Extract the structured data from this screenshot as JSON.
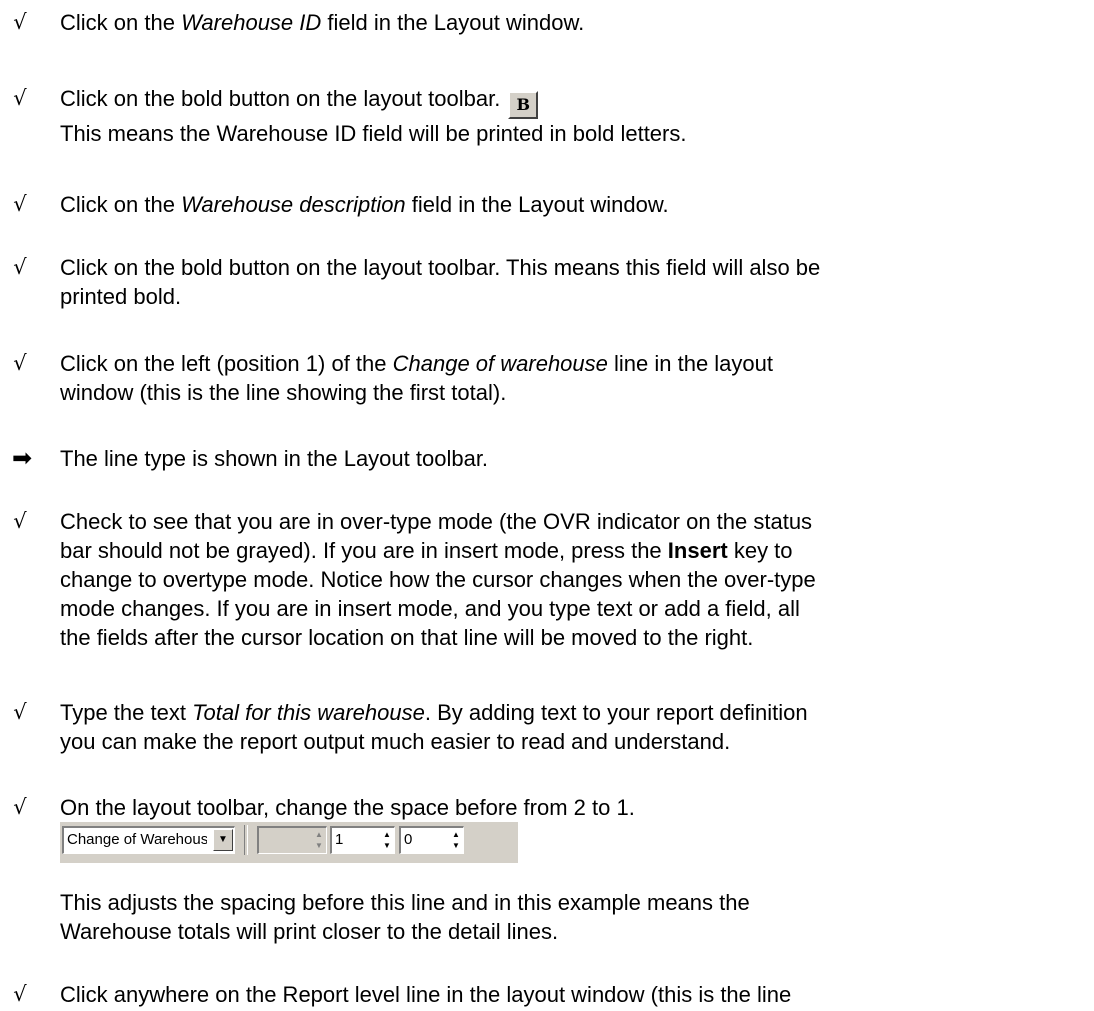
{
  "steps": [
    {
      "mark": "√",
      "pre": "Click on the ",
      "em": "Warehouse ID",
      "post": " field in the Layout window."
    },
    {
      "mark": "√",
      "line1": "Click on the bold button on the layout toolbar.",
      "button_label": "B",
      "line2": "This means the Warehouse ID field will be printed in bold letters."
    },
    {
      "mark": "√",
      "pre": "Click on the ",
      "em": "Warehouse description",
      "post": " field in the Layout window."
    },
    {
      "mark": "√",
      "line1": "Click on the bold button on the layout toolbar. This means this field will also be",
      "line2": "printed bold."
    },
    {
      "mark": "√",
      "pre": "Click on the left (position 1) of the ",
      "em": "Change of warehouse",
      "post": " line in the layout",
      "line2": "window (this is the line showing the first total)."
    },
    {
      "mark": "➡",
      "text": "The line type is shown in the Layout toolbar."
    },
    {
      "mark": "√",
      "line1": "Check to see that you are in over-type mode (the OVR indicator on the status",
      "line2_pre": "bar should not be grayed). If you are in insert mode, press the ",
      "line2_bold": "Insert",
      "line2_post": " key to",
      "line3": "change to overtype mode. Notice how the cursor changes when the over-type",
      "line4": "mode changes. If you are in insert mode, and you type text or add a field, all",
      "line5": "the fields after the cursor location on that line will be moved to the right."
    },
    {
      "mark": "√",
      "pre": "Type the text ",
      "em": "Total for this warehouse",
      "post": ". By adding text to your report definition",
      "line2": "you can make the report output much easier to read and understand."
    },
    {
      "mark": "√",
      "line1": "On the layout toolbar, change the space before from 2 to 1.",
      "after1": "This adjusts the spacing before this line and in this example means the",
      "after2": "Warehouse totals will print closer to the detail lines."
    },
    {
      "mark": "√",
      "line1": "Click anywhere on the Report level line in the layout window (this is the line"
    }
  ],
  "toolbar": {
    "line_type": "Change of Warehouse",
    "spin1": "",
    "spin2": "1",
    "spin3": "0"
  }
}
